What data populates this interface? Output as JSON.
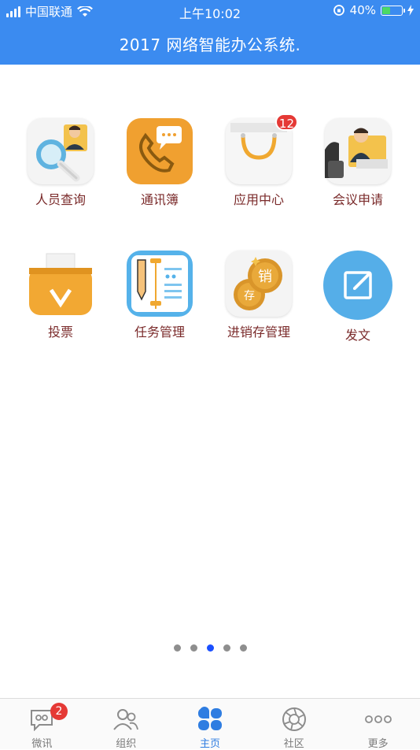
{
  "status": {
    "carrier": "中国联通",
    "time": "上午10:02",
    "battery": "40%"
  },
  "title": "2017 网络智能办公系统.",
  "apps": [
    {
      "label": "人员查询",
      "icon": "person-search-icon"
    },
    {
      "label": "通讯簿",
      "icon": "phone-book-icon"
    },
    {
      "label": "应用中心",
      "icon": "shopping-bag-icon",
      "badge": "12"
    },
    {
      "label": "会议申请",
      "icon": "meeting-icon"
    },
    {
      "label": "投票",
      "icon": "ballot-box-icon"
    },
    {
      "label": "任务管理",
      "icon": "task-notebook-icon"
    },
    {
      "label": "进销存管理",
      "icon": "coins-icon"
    },
    {
      "label": "发文",
      "icon": "edit-document-icon"
    }
  ],
  "pager": {
    "count": 5,
    "active": 2
  },
  "tabs": [
    {
      "label": "微讯",
      "icon": "chat-icon",
      "badge": "2"
    },
    {
      "label": "组织",
      "icon": "people-icon"
    },
    {
      "label": "主页",
      "icon": "home-petals-icon"
    },
    {
      "label": "社区",
      "icon": "aperture-icon"
    },
    {
      "label": "更多",
      "icon": "more-dots-icon"
    }
  ],
  "colors": {
    "primary": "#3b8bf0",
    "active_tab": "#2f7de1",
    "badge": "#e53935",
    "label": "#7a2a2a"
  }
}
